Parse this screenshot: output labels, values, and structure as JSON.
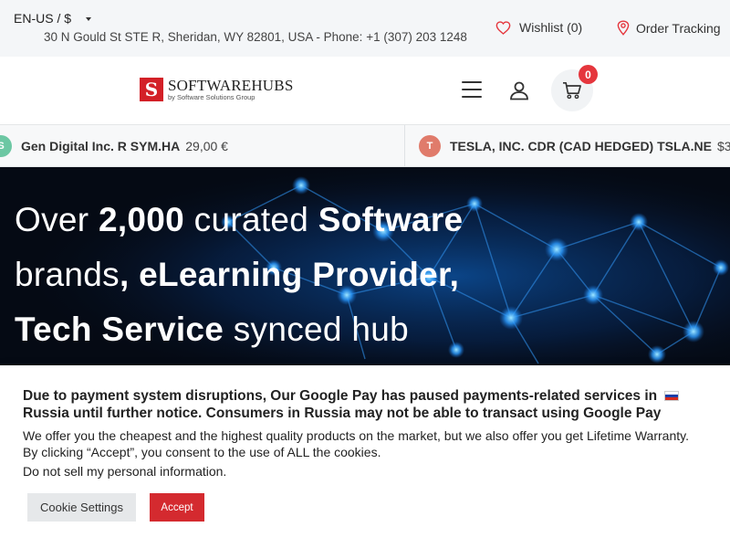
{
  "topbar": {
    "locale": "EN-US / $",
    "address": "30 N Gould St STE R, Sheridan, WY 82801, USA - Phone: +1 (307) 203 1248",
    "wishlist_label": "Wishlist (0)",
    "tracking_label": "Order Tracking",
    "icons": {
      "wishlist": "heart-icon",
      "tracking": "map-pin-icon"
    }
  },
  "header": {
    "logo_mark": "S",
    "logo_name": "SOFTWAREHUBS",
    "logo_tagline": "by Software Solutions Group",
    "cart_count": "0",
    "icons": {
      "menu": "hamburger-icon",
      "account": "user-icon",
      "cart": "cart-icon"
    },
    "colors": {
      "brand_red": "#d32027",
      "badge": "#e5363d"
    }
  },
  "ticker": [
    {
      "icon_letter": "S",
      "icon_color": "#6cc7a3",
      "name": "Gen Digital Inc. R SYM.HA",
      "price": "29,00 €"
    },
    {
      "icon_letter": "T",
      "icon_color": "#e07b6b",
      "name": "TESLA, INC. CDR (CAD HEDGED) TSLA.NE",
      "price": "$3"
    }
  ],
  "hero": {
    "l1_a": "Over ",
    "l1_b": "2,000",
    "l1_c": " curated ",
    "l1_d": "Software",
    "l2_a": "brands",
    "l2_b": ", eLearning Provider,",
    "l3_a": "Tech Service",
    "l3_b": " synced hub"
  },
  "cookie": {
    "notice": "Due to payment system disruptions, Our Google Pay has paused payments-related services in",
    "notice_tail": "Russia until further notice. Consumers in Russia may not be able to transact using Google Pay",
    "consent": "We offer you the cheapest and the highest quality products on the market, but we also offer you get Lifetime Warranty. By clicking “Accept”, you consent to the use of ALL the cookies.",
    "do_not_sell": "Do not sell my personal information.",
    "settings_label": "Cookie Settings",
    "accept_label": "Accept",
    "colors": {
      "accept": "#d42a2f",
      "settings": "#e6e8ea"
    }
  }
}
